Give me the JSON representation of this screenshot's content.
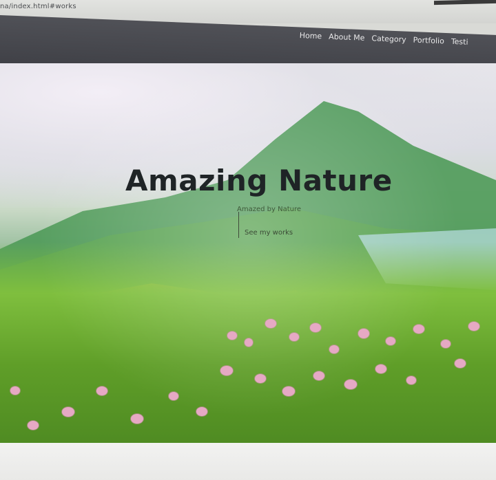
{
  "browser": {
    "url": "na/index.html#works"
  },
  "nav": {
    "items": [
      {
        "label": "Home"
      },
      {
        "label": "About Me"
      },
      {
        "label": "Category"
      },
      {
        "label": "Portfolio"
      },
      {
        "label": "Testi"
      }
    ]
  },
  "hero": {
    "title": "Amazing Nature",
    "subtitle": "Amazed by Nature",
    "cta_label": "See my works"
  },
  "colors": {
    "navbar": "#46474d",
    "title": "#1f2426",
    "grass": "#6fae33",
    "flowers": "#e6a9c4"
  }
}
